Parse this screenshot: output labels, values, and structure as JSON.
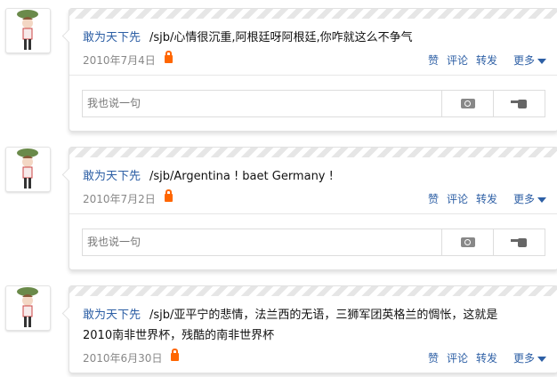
{
  "posts": [
    {
      "author": "敢为天下先",
      "text": "/sjb/心情很沉重,阿根廷呀阿根廷,你咋就这么不争气",
      "date": "2010年7月4日",
      "reply_placeholder": "我也说一句"
    },
    {
      "author": "敢为天下先",
      "text": "/sjb/Argentina ! baet Germany !",
      "date": "2010年7月2日",
      "reply_placeholder": "我也说一句"
    },
    {
      "author": "敢为天下先",
      "text": "/sjb/亚平宁的悲情，法兰西的无语，三狮军团英格兰的惆怅，这就是2010南非世界杯，残酷的南非世界杯",
      "date": "2010年6月30日"
    }
  ],
  "actions": {
    "like": "赞",
    "comment": "评论",
    "forward": "转发",
    "more": "更多"
  }
}
